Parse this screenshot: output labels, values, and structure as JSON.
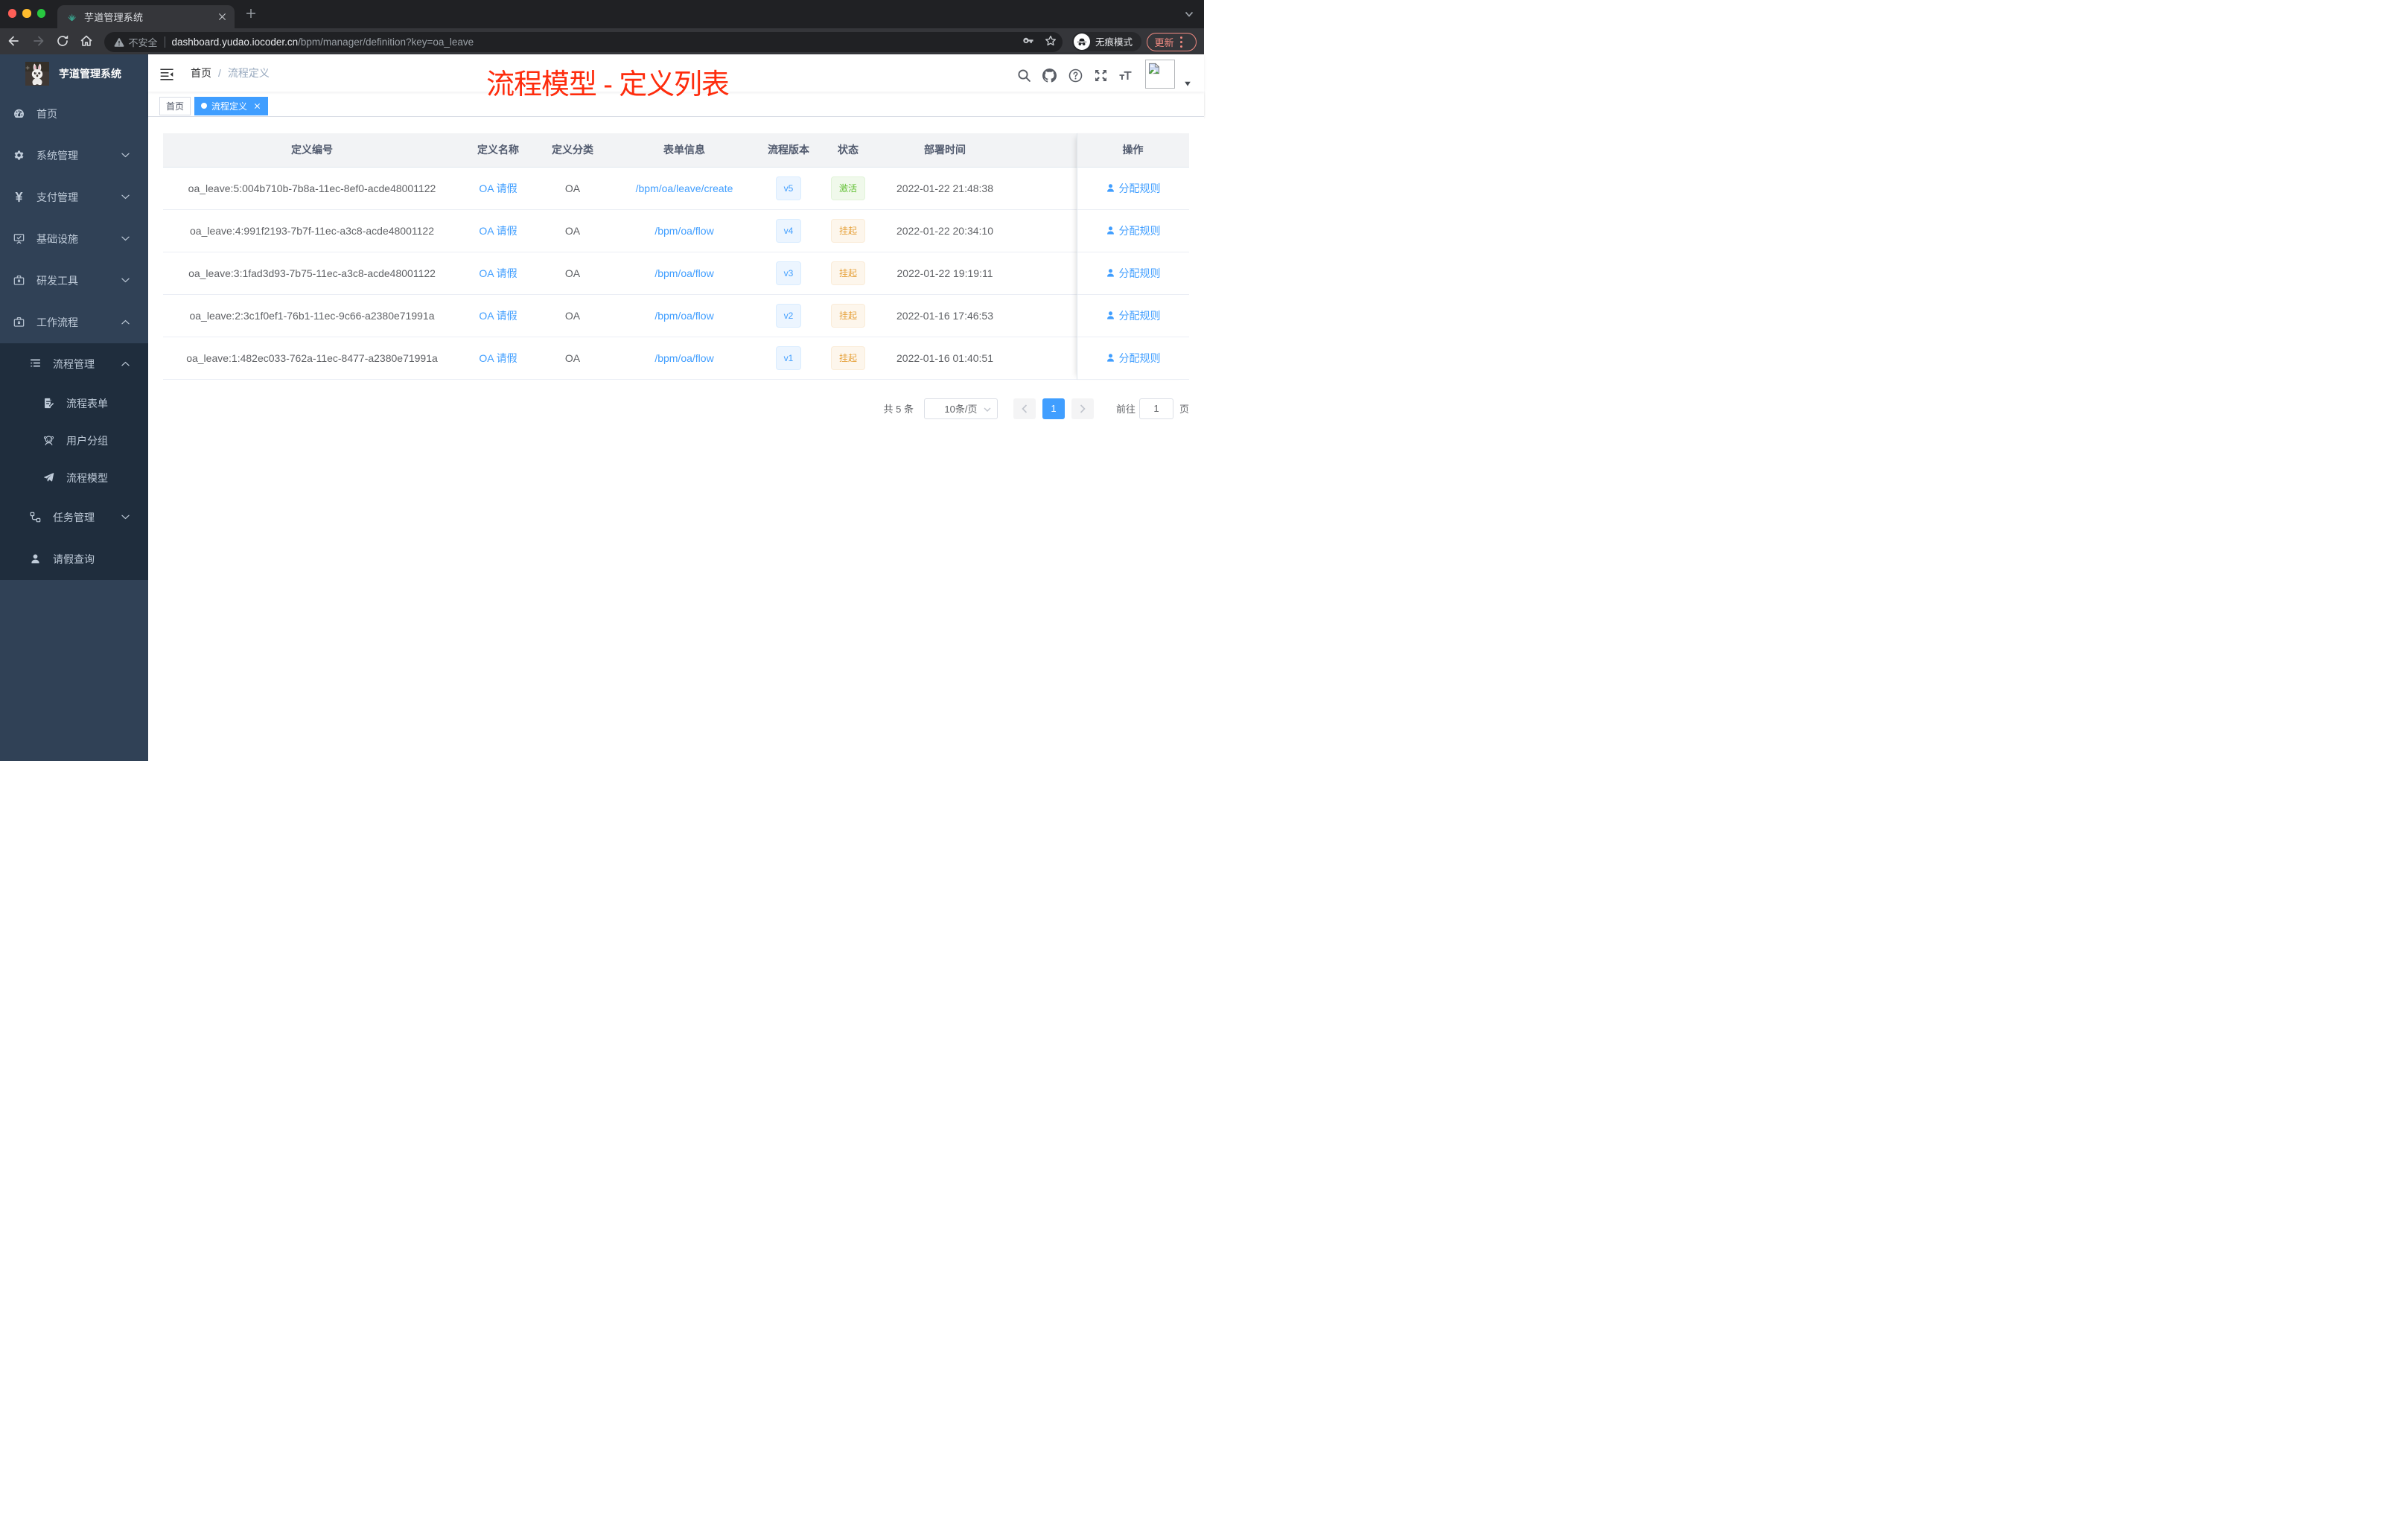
{
  "browser": {
    "tab_title": "芋道管理系统",
    "security_label": "不安全",
    "url_domain": "dashboard.yudao.iocoder.cn",
    "url_path": "/bpm/manager/definition?key=oa_leave",
    "incognito_label": "无痕模式",
    "update_label": "更新",
    "traffic_colors": {
      "close": "#ff5f57",
      "minimize": "#febc2e",
      "zoom": "#28c840"
    }
  },
  "sidebar": {
    "logo_title": "芋道管理系统",
    "items": [
      {
        "label": "首页",
        "icon": "dashboard-icon",
        "level": 0,
        "arrow": "none"
      },
      {
        "label": "系统管理",
        "icon": "gear-icon",
        "level": 0,
        "arrow": "down"
      },
      {
        "label": "支付管理",
        "icon": "yen-icon",
        "level": 0,
        "arrow": "down"
      },
      {
        "label": "基础设施",
        "icon": "monitor-icon",
        "level": 0,
        "arrow": "down"
      },
      {
        "label": "研发工具",
        "icon": "toolbox-icon",
        "level": 0,
        "arrow": "down"
      },
      {
        "label": "工作流程",
        "icon": "toolbox-icon",
        "level": 0,
        "arrow": "up"
      },
      {
        "label": "流程管理",
        "icon": "list-icon",
        "level": 1,
        "arrow": "up",
        "dark": true
      },
      {
        "label": "流程表单",
        "icon": "form-icon",
        "level": 2,
        "arrow": "none",
        "dark": true
      },
      {
        "label": "用户分组",
        "icon": "face-icon",
        "level": 2,
        "arrow": "none",
        "dark": true
      },
      {
        "label": "流程模型",
        "icon": "send-icon",
        "level": 2,
        "arrow": "none",
        "dark": true
      },
      {
        "label": "任务管理",
        "icon": "tree-icon",
        "level": 1,
        "arrow": "down",
        "dark": true
      },
      {
        "label": "请假查询",
        "icon": "person-icon",
        "level": 1,
        "arrow": "none",
        "dark": true
      }
    ]
  },
  "navbar": {
    "breadcrumb": {
      "home": "首页",
      "separator": "/",
      "current": "流程定义"
    },
    "annotation": "流程模型 - 定义列表",
    "annotation_color": "#fe2c0d"
  },
  "tags": [
    {
      "label": "首页",
      "active": false,
      "closable": false
    },
    {
      "label": "流程定义",
      "active": true,
      "closable": true
    }
  ],
  "table": {
    "columns": [
      "定义编号",
      "定义名称",
      "定义分类",
      "表单信息",
      "流程版本",
      "状态",
      "部署时间",
      "操作"
    ],
    "rows": [
      {
        "id": "oa_leave:5:004b710b-7b8a-11ec-8ef0-acde48001122",
        "name": "OA 请假",
        "category": "OA",
        "form": "/bpm/oa/leave/create",
        "version": "v5",
        "status": "激活",
        "status_type": "success",
        "time": "2022-01-22 21:48:38",
        "action": "分配规则"
      },
      {
        "id": "oa_leave:4:991f2193-7b7f-11ec-a3c8-acde48001122",
        "name": "OA 请假",
        "category": "OA",
        "form": "/bpm/oa/flow",
        "version": "v4",
        "status": "挂起",
        "status_type": "warning",
        "time": "2022-01-22 20:34:10",
        "action": "分配规则"
      },
      {
        "id": "oa_leave:3:1fad3d93-7b75-11ec-a3c8-acde48001122",
        "name": "OA 请假",
        "category": "OA",
        "form": "/bpm/oa/flow",
        "version": "v3",
        "status": "挂起",
        "status_type": "warning",
        "time": "2022-01-22 19:19:11",
        "action": "分配规则"
      },
      {
        "id": "oa_leave:2:3c1f0ef1-76b1-11ec-9c66-a2380e71991a",
        "name": "OA 请假",
        "category": "OA",
        "form": "/bpm/oa/flow",
        "version": "v2",
        "status": "挂起",
        "status_type": "warning",
        "time": "2022-01-16 17:46:53",
        "action": "分配规则"
      },
      {
        "id": "oa_leave:1:482ec033-762a-11ec-8477-a2380e71991a",
        "name": "OA 请假",
        "category": "OA",
        "form": "/bpm/oa/flow",
        "version": "v1",
        "status": "挂起",
        "status_type": "warning",
        "time": "2022-01-16 01:40:51",
        "action": "分配规则"
      }
    ]
  },
  "pagination": {
    "total_label": "共 5 条",
    "page_size_label": "10条/页",
    "current_page": "1",
    "goto_label": "前往",
    "goto_value": "1",
    "page_unit_label": "页"
  }
}
